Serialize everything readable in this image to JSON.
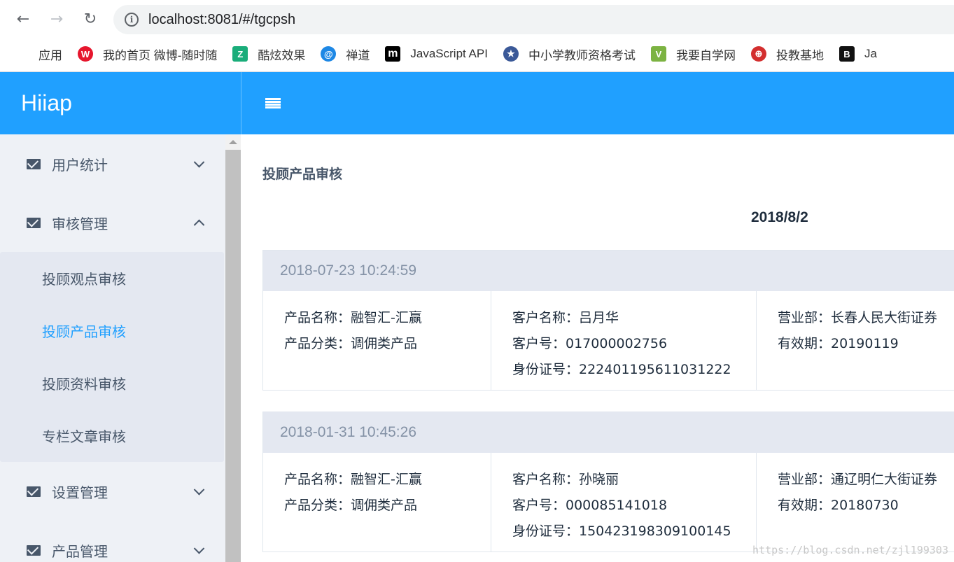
{
  "browser": {
    "url": "localhost:8081/#/tgcpsh",
    "bookmarks": [
      {
        "label": "应用",
        "icon": "apps-grid-icon",
        "color": "#e94235"
      },
      {
        "label": "我的首页 微博-随时随",
        "icon": "weibo-icon",
        "color": "#e6162d"
      },
      {
        "label": "酷炫效果",
        "icon": "kuxuan-icon",
        "color": "#1aad7a"
      },
      {
        "label": "禅道",
        "icon": "zentao-icon",
        "color": "#1e88e5"
      },
      {
        "label": "JavaScript API",
        "icon": "m-icon",
        "color": "#000000"
      },
      {
        "label": "中小学教师资格考试",
        "icon": "exam-seal-icon",
        "color": "#3b5998"
      },
      {
        "label": "我要自学网",
        "icon": "zixue-icon",
        "color": "#7cb342"
      },
      {
        "label": "投教基地",
        "icon": "toujiao-icon",
        "color": "#d32f2f"
      },
      {
        "label": "Ja",
        "icon": "b-icon",
        "color": "#111111"
      }
    ]
  },
  "header": {
    "brand": "Hiiap",
    "accent": "#20a0ff"
  },
  "sidebar": {
    "groups": [
      {
        "label": "用户统计",
        "expanded": false
      },
      {
        "label": "审核管理",
        "expanded": true,
        "items": [
          {
            "label": "投顾观点审核",
            "active": false
          },
          {
            "label": "投顾产品审核",
            "active": true
          },
          {
            "label": "投顾资料审核",
            "active": false
          },
          {
            "label": "专栏文章审核",
            "active": false
          }
        ]
      },
      {
        "label": "设置管理",
        "expanded": false
      },
      {
        "label": "产品管理",
        "expanded": false
      }
    ]
  },
  "main": {
    "title": "投顾产品审核",
    "date": "2018/8/2",
    "cards": [
      {
        "timestamp": "2018-07-23 10:24:59",
        "product_name": "产品名称：融智汇-汇赢",
        "product_category": "产品分类：调佣类产品",
        "customer_name": "客户名称：吕月华",
        "customer_no": "客户号：017000002756",
        "id_no": "身份证号：222401195611031222",
        "branch": "营业部：长春人民大街证券",
        "validity": "有效期：20190119"
      },
      {
        "timestamp": "2018-01-31 10:45:26",
        "product_name": "产品名称：融智汇-汇赢",
        "product_category": "产品分类：调佣类产品",
        "customer_name": "客户名称：孙晓丽",
        "customer_no": "客户号：000085141018",
        "id_no": "身份证号：150423198309100145",
        "branch": "营业部：通辽明仁大街证券",
        "validity": "有效期：20180730"
      }
    ]
  },
  "watermark": "https://blog.csdn.net/zjl199303"
}
